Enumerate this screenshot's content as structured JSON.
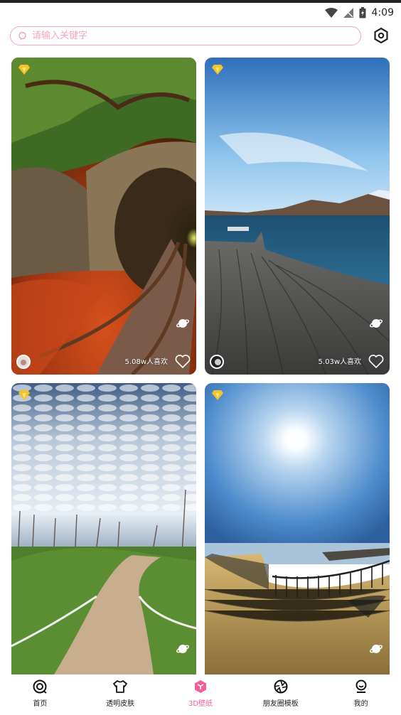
{
  "status_bar": {
    "time": "4:09"
  },
  "search": {
    "placeholder": "请输入关键字"
  },
  "cards": [
    {
      "likes": "5.08w人喜欢"
    },
    {
      "likes": "5.03w人喜欢"
    },
    {
      "likes": ""
    },
    {
      "likes": ""
    }
  ],
  "tabs": [
    {
      "label": "首页",
      "icon": "home-icon"
    },
    {
      "label": "透明皮肤",
      "icon": "shirt-icon"
    },
    {
      "label": "3D壁纸",
      "icon": "cube-icon"
    },
    {
      "label": "朋友圈模板",
      "icon": "aperture-icon"
    },
    {
      "label": "我的",
      "icon": "profile-icon"
    }
  ],
  "colors": {
    "accent": "#f25d9c",
    "search_border": "#f3a6c4",
    "vip_gold": "#f6c325"
  }
}
